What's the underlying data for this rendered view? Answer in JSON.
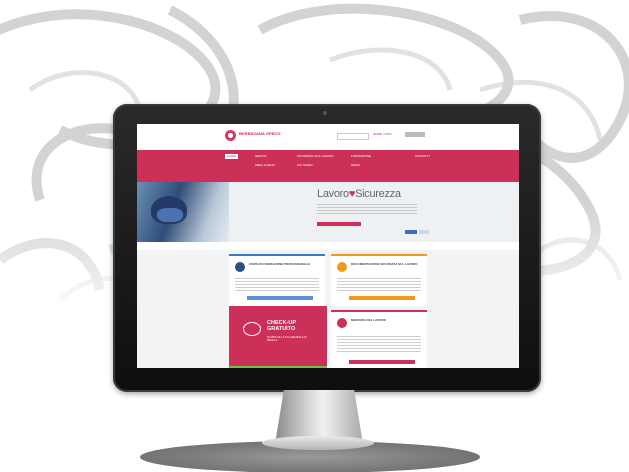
{
  "site": {
    "logo_text": "BERENZANA SPECO",
    "top_links": "HOME / INFO",
    "nav": {
      "items": [
        {
          "label": "HOME",
          "active": true
        },
        {
          "label": "SERVIZI"
        },
        {
          "label": "SICUREZZA SUL LAVORO"
        },
        {
          "label": "FORMAZIONE"
        },
        {
          "label": "CONTATTI"
        },
        {
          "label": "AREA CLIENTI"
        },
        {
          "label": "CHI SIAMO"
        },
        {
          "label": "NEWS"
        }
      ]
    },
    "hero": {
      "title_part1": "Lavoro",
      "title_heart": "♥",
      "title_part2": "Sicurezza"
    },
    "cards": [
      {
        "title": "CORSI DI FORMAZIONE PROFESSIONALE",
        "accent": "#3b7bcc"
      },
      {
        "title": "DOCUMENTAZIONE SICUREZZA SUL LAVORO",
        "accent": "#f09a1a"
      },
      {
        "title": "MEDICINA DEL LAVORO",
        "accent": "#cc2f57"
      }
    ],
    "promo": {
      "title": "CHECK-UP GRATUITO",
      "subtitle": "SCOPRI SE LA TUA AZIENDA È IN REGOLA"
    }
  },
  "colors": {
    "brand": "#cc2f57",
    "blue": "#3b7bcc",
    "orange": "#f09a1a"
  }
}
